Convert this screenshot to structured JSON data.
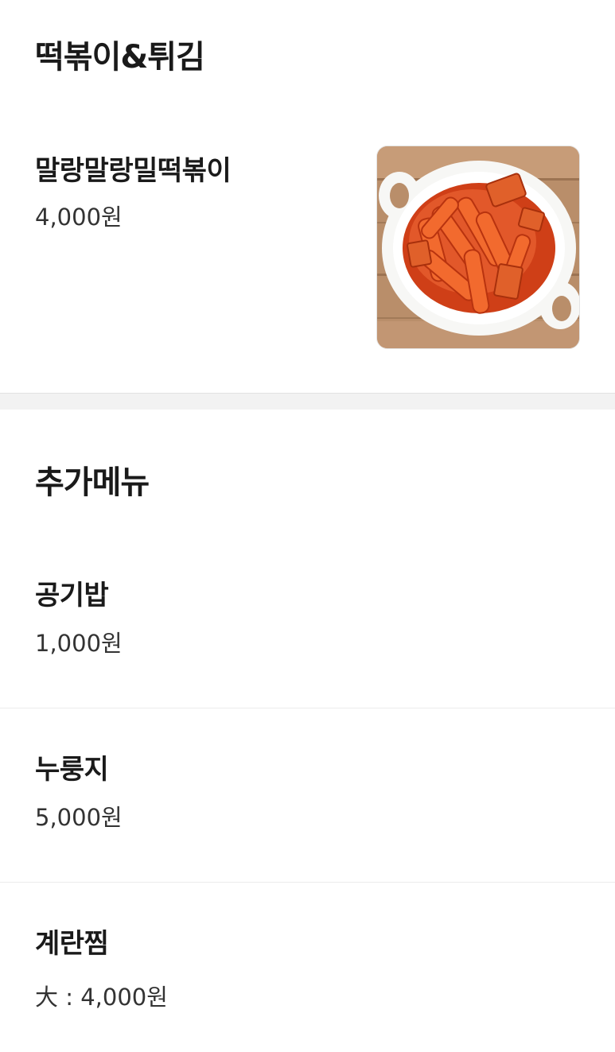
{
  "sections": [
    {
      "title": "떡볶이&튀김",
      "items": [
        {
          "name": "말랑말랑밀떡볶이",
          "price": "4,000원",
          "image": "tteokbokki-photo"
        }
      ]
    },
    {
      "title": "추가메뉴",
      "items": [
        {
          "name": "공기밥",
          "price": "1,000원"
        },
        {
          "name": "누룽지",
          "price": "5,000원"
        },
        {
          "name": "계란찜",
          "price": "大 : 4,000원"
        }
      ]
    }
  ],
  "colors": {
    "background": "#ffffff",
    "section_gap": "#f2f2f2",
    "text_primary": "#1a1a1a",
    "text_secondary": "#333333",
    "sauce": "#d4471e"
  }
}
